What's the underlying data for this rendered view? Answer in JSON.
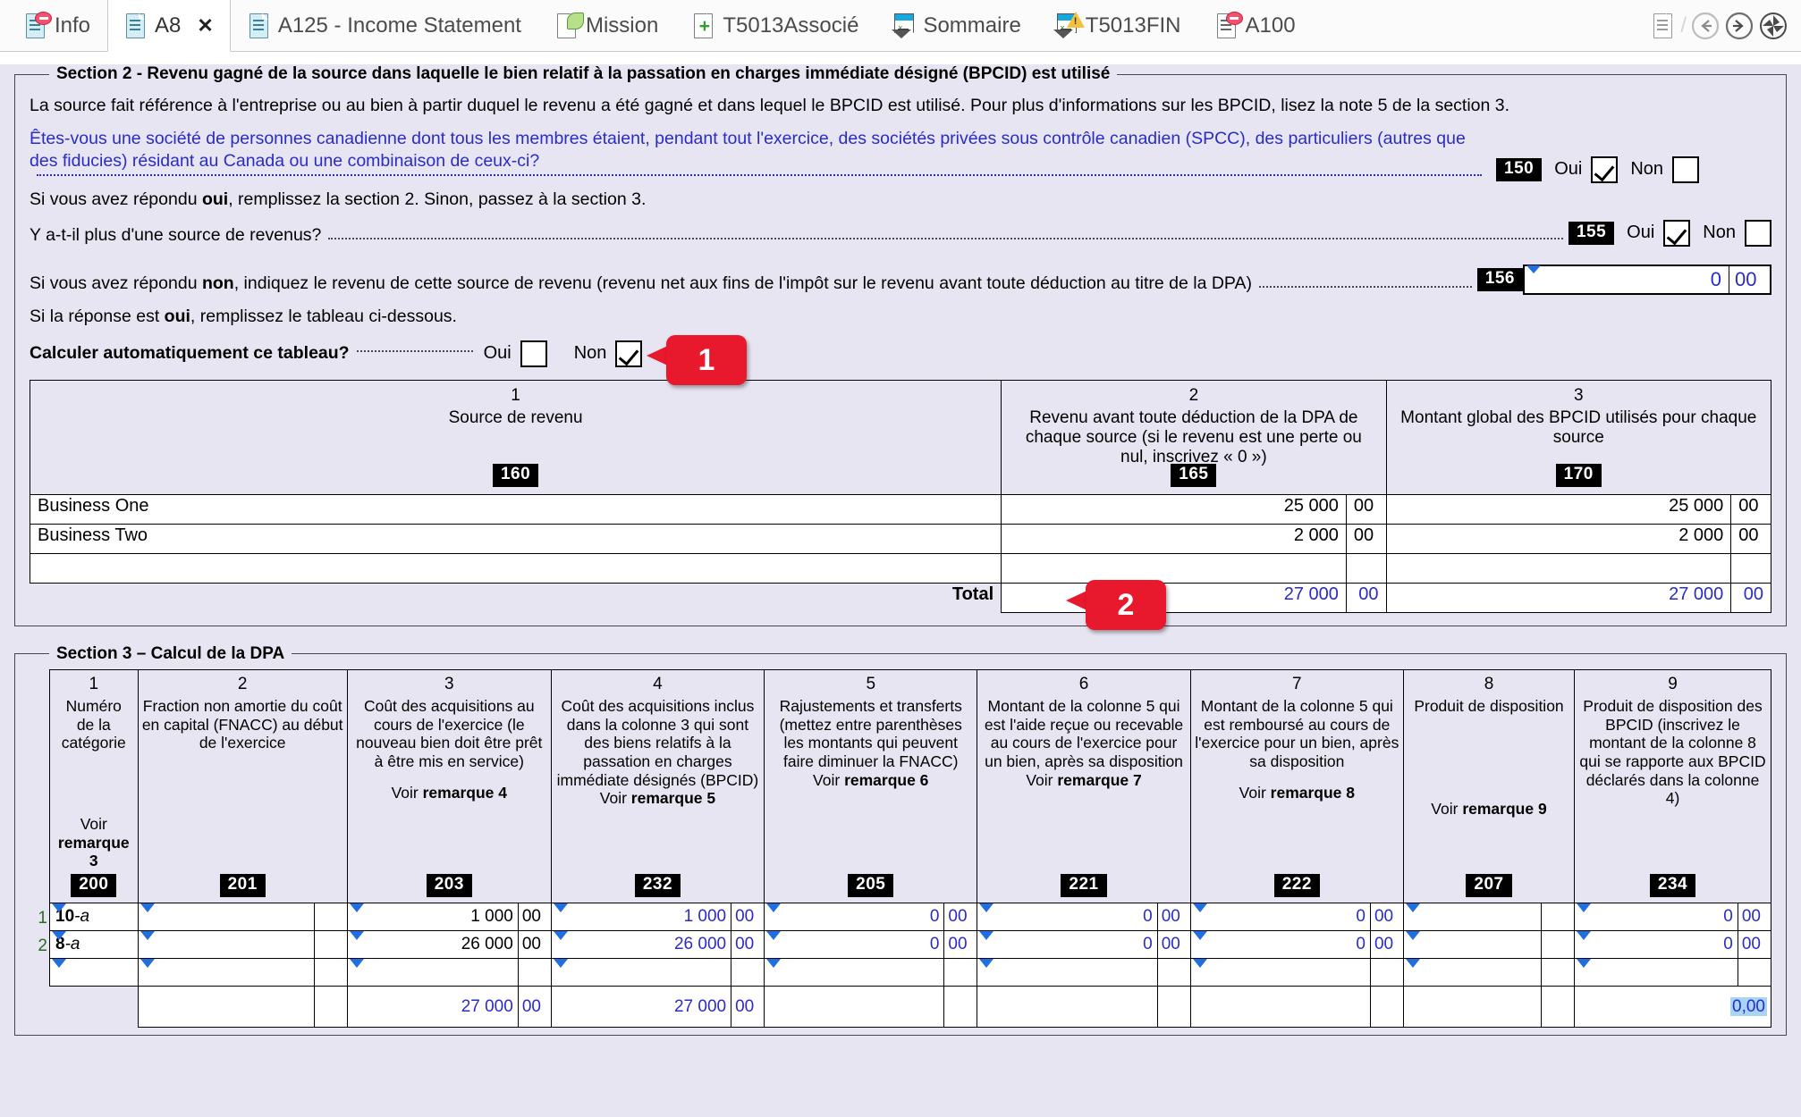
{
  "tabs": [
    {
      "label": "Info",
      "icon": "document-minus-icon",
      "active": false
    },
    {
      "label": "A8",
      "icon": "document-icon",
      "active": true,
      "closable": true
    },
    {
      "label": "A125 - Income Statement",
      "icon": "document-icon",
      "active": false
    },
    {
      "label": "Mission",
      "icon": "document-leaf-icon",
      "active": false
    },
    {
      "label": "T5013Associé",
      "icon": "document-plus-icon",
      "active": false
    },
    {
      "label": "Sommaire",
      "icon": "envelope-icon",
      "active": false
    },
    {
      "label": "T5013FIN",
      "icon": "envelope-warning-icon",
      "active": false
    },
    {
      "label": "A100",
      "icon": "document-minus-icon",
      "active": false
    }
  ],
  "tab_close_label": "✕",
  "nav": {
    "page_icon": "document-icon",
    "separator": "/",
    "back": "arrow-left-circle-icon",
    "forward": "arrow-right-circle-icon",
    "refresh": "refresh-icon"
  },
  "section2": {
    "legend": "Section 2 - Revenu gagné de la source dans laquelle le bien relatif à la passation en charges immédiate désigné (BPCID) est utilisé",
    "intro": "La source fait référence à l'entreprise ou au bien à partir duquel le revenu a été gagné et dans lequel le BPCID est utilisé. Pour plus d'informations sur les BPCID, lisez la note 5 de la section 3.",
    "q150": {
      "text": "Êtes-vous une société de personnes canadienne dont tous les membres étaient, pendant tout l'exercice, des sociétés privées sous contrôle canadien (SPCC), des particuliers (autres que des fiducies) résidant au Canada ou une combinaison de ceux-ci?",
      "field": "150",
      "yes_label": "Oui",
      "no_label": "Non",
      "yes_checked": true,
      "no_checked": false
    },
    "note_oui": "Si vous avez répondu oui, remplissez la section 2. Sinon, passez à la section 3.",
    "note_oui_parts": {
      "a": "Si vous avez répondu ",
      "b": "oui",
      "c": ", remplissez la section 2. Sinon, passez à la section 3."
    },
    "q155": {
      "text": "Y a-t-il plus d'une source de revenus?",
      "field": "155",
      "yes_label": "Oui",
      "no_label": "Non",
      "yes_checked": true,
      "no_checked": false
    },
    "q156": {
      "text_a": "Si vous avez répondu ",
      "text_b": "non",
      "text_c": ", indiquez le revenu de cette source de revenu (revenu net aux fins de l'impôt sur le revenu avant toute déduction au titre de la DPA)",
      "field": "156",
      "amount": "0",
      "cents": "00"
    },
    "note_tableau_a": "Si la réponse est ",
    "note_tableau_b": "oui",
    "note_tableau_c": ", remplissez le tableau ci-dessous.",
    "autocalc": {
      "label": "Calculer automatiquement ce tableau?",
      "yes_label": "Oui",
      "no_label": "Non",
      "yes_checked": false,
      "no_checked": true
    },
    "table": {
      "headers": [
        {
          "num": "1",
          "title": "Source de revenu",
          "field": "160"
        },
        {
          "num": "2",
          "title": "Revenu avant toute déduction de la DPA de chaque source (si le revenu est une perte ou nul, inscrivez « 0 »)",
          "field": "165"
        },
        {
          "num": "3",
          "title": "Montant global des BPCID utilisés pour chaque source",
          "field": "170"
        }
      ],
      "rows": [
        {
          "source": "Business One",
          "c2": "25 000",
          "c2c": "00",
          "c3": "25 000",
          "c3c": "00"
        },
        {
          "source": "Business Two",
          "c2": "2 000",
          "c2c": "00",
          "c3": "2 000",
          "c3c": "00"
        },
        {
          "source": "",
          "c2": "",
          "c2c": "",
          "c3": "",
          "c3c": ""
        }
      ],
      "total_label": "Total",
      "total_c2": "27 000",
      "total_c2c": "00",
      "total_c3": "27 000",
      "total_c3c": "00"
    }
  },
  "section3": {
    "legend": "Section 3 – Calcul de la DPA",
    "headers": [
      {
        "num": "1",
        "title": "Numéro\nde la\ncatégorie",
        "see": "Voir\nremarque 3",
        "see_plain": "Voir",
        "see_bold": "remarque 3",
        "field": "200"
      },
      {
        "num": "2",
        "title": "Fraction non amortie du coût en capital (FNACC) au début de l'exercice",
        "see_plain": "",
        "see_bold": "",
        "field": "201"
      },
      {
        "num": "3",
        "title": "Coût des acquisitions au cours de l'exercice (le nouveau bien doit être prêt à être mis en service)",
        "see_plain": "Voir",
        "see_bold": "remarque 4",
        "field": "203"
      },
      {
        "num": "4",
        "title": "Coût des acquisitions inclus dans la colonne 3 qui sont des biens relatifs à la passation en charges immédiate désignés (BPCID)",
        "see_plain": "Voir",
        "see_bold": "remarque 5",
        "field": "232"
      },
      {
        "num": "5",
        "title": "Rajustements et transferts (mettez entre parenthèses les montants qui peuvent faire diminuer la FNACC)",
        "see_plain": "Voir",
        "see_bold": "remarque 6",
        "field": "205"
      },
      {
        "num": "6",
        "title": "Montant de la colonne 5 qui est l'aide reçue ou recevable au cours de l'exercice pour un bien, après sa disposition",
        "see_plain": "Voir",
        "see_bold": "remarque 7",
        "field": "221"
      },
      {
        "num": "7",
        "title": "Montant de la colonne 5 qui est remboursé au cours de l'exercice pour un bien, après sa disposition",
        "see_plain": "Voir",
        "see_bold": "remarque 8",
        "field": "222"
      },
      {
        "num": "8",
        "title": "Produit de disposition",
        "see_plain": "Voir",
        "see_bold": "remarque 9",
        "field": "207"
      },
      {
        "num": "9",
        "title": "Produit de disposition des BPCID (inscrivez le montant de la colonne 8 qui se rapporte aux BPCID déclarés dans la colonne 4)",
        "see_plain": "",
        "see_bold": "",
        "field": "234"
      }
    ],
    "row_numbers": [
      "1",
      "2",
      ""
    ],
    "rows": [
      {
        "cat_bold": "10",
        "cat_italic": "-a",
        "c2": "",
        "c2c": "",
        "c3": "1 000",
        "c3c": "00",
        "c4": "1 000",
        "c4c": "00",
        "c5": "0",
        "c5c": "00",
        "c6": "0",
        "c6c": "00",
        "c7": "0",
        "c7c": "00",
        "c8": "",
        "c8c": "",
        "c9": "0",
        "c9c": "00"
      },
      {
        "cat_bold": "8",
        "cat_italic": "-a",
        "c2": "",
        "c2c": "",
        "c3": "26 000",
        "c3c": "00",
        "c4": "26 000",
        "c4c": "00",
        "c5": "0",
        "c5c": "00",
        "c6": "0",
        "c6c": "00",
        "c7": "0",
        "c7c": "00",
        "c8": "",
        "c8c": "",
        "c9": "0",
        "c9c": "00"
      },
      {
        "cat_bold": "",
        "cat_italic": "",
        "c2": "",
        "c2c": "",
        "c3": "",
        "c3c": "",
        "c4": "",
        "c4c": "",
        "c5": "",
        "c5c": "",
        "c6": "",
        "c6c": "",
        "c7": "",
        "c7c": "",
        "c8": "",
        "c8c": "",
        "c9": "",
        "c9c": ""
      }
    ],
    "totals": {
      "c3": "27 000",
      "c3c": "00",
      "c4": "27 000",
      "c4c": "00",
      "c9_selected": "0,00"
    }
  },
  "callouts": [
    {
      "number": "1"
    },
    {
      "number": "2"
    }
  ],
  "colors": {
    "form_bg": "#e7e5f1",
    "blue_text": "#2b2bc8",
    "callout_red": "#e8192c",
    "field_black": "#000000",
    "selection_blue": "#a8d4f5"
  }
}
